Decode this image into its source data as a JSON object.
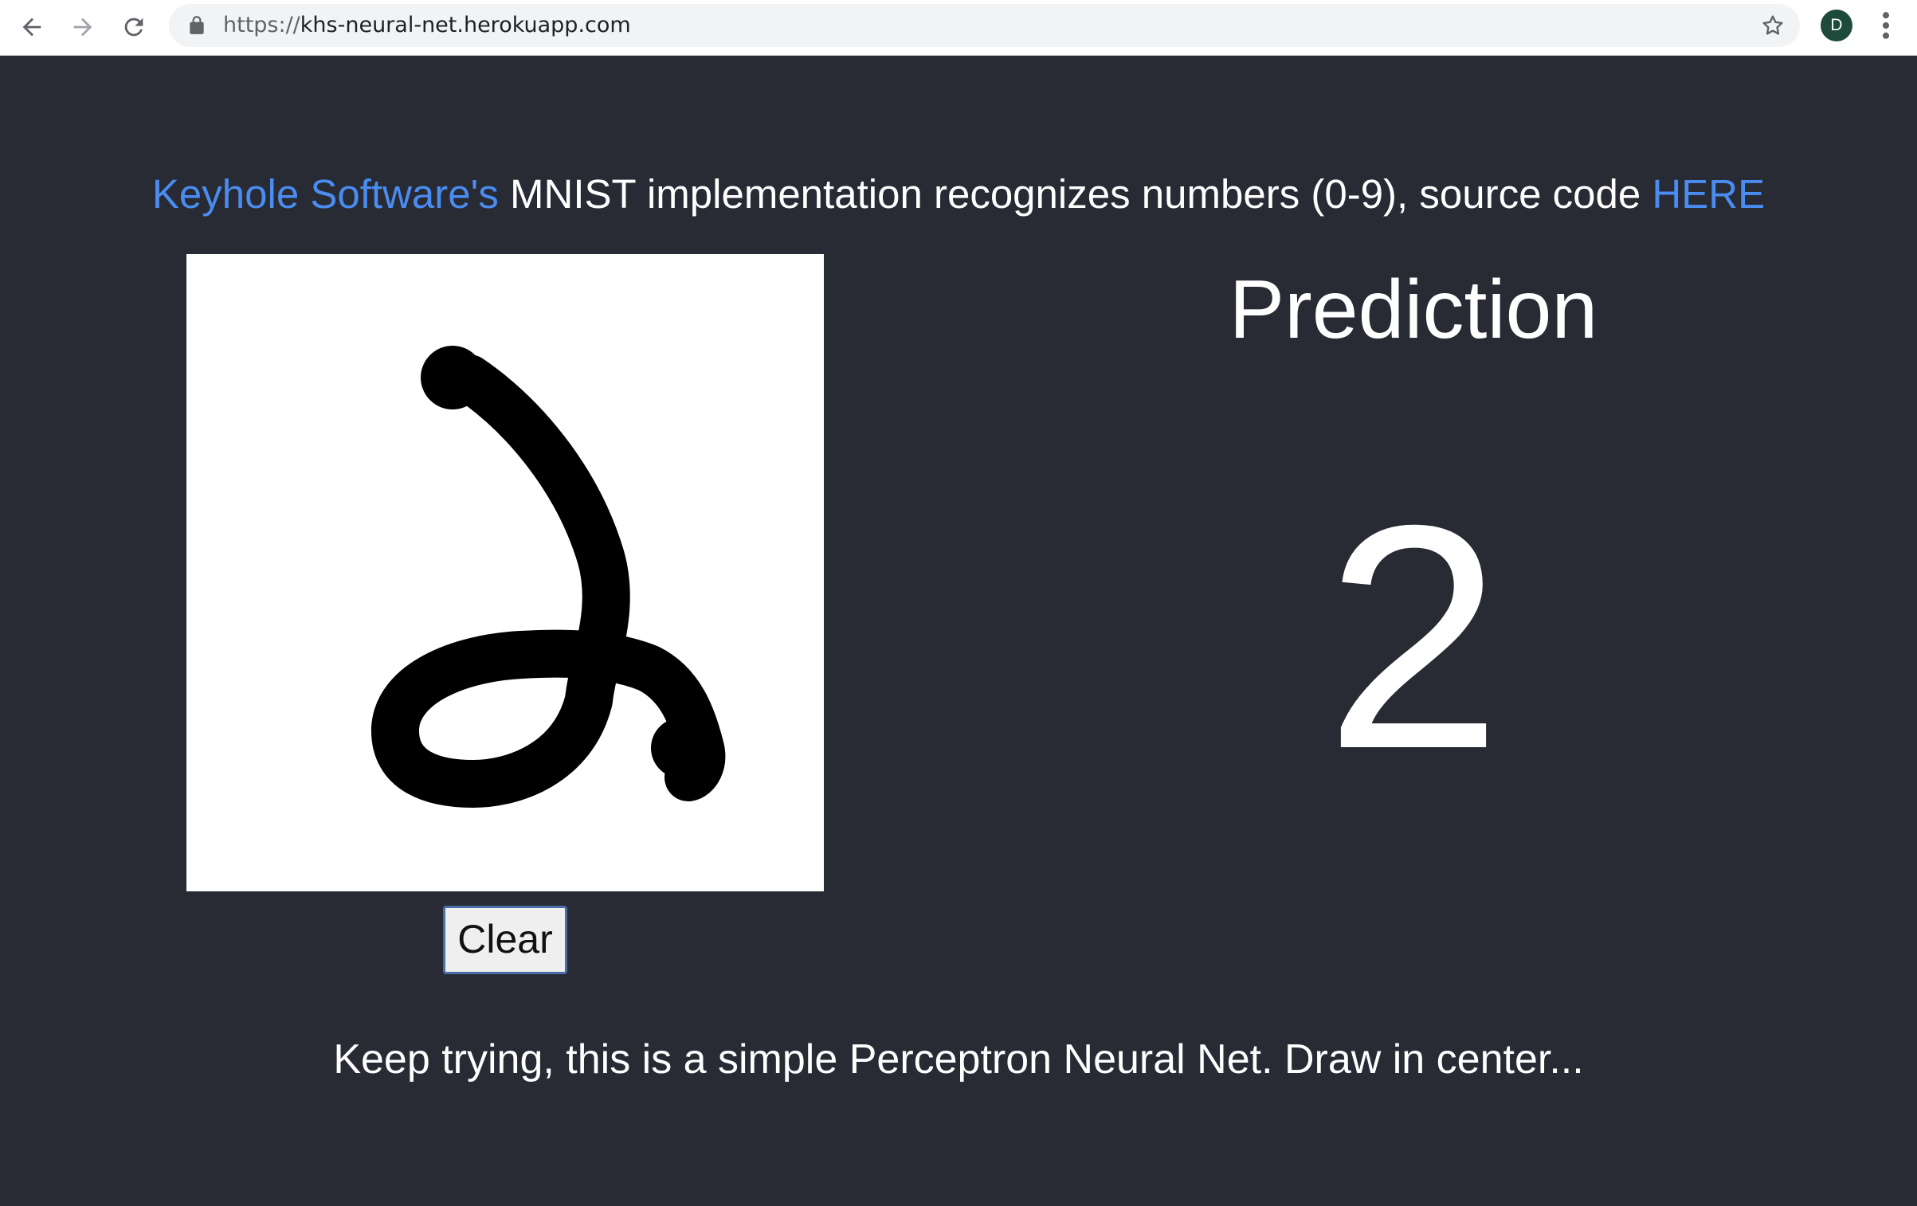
{
  "browser": {
    "url_scheme": "https://",
    "url_host": "khs-neural-net.herokuapp.com",
    "avatar_letter": "D"
  },
  "header": {
    "link_text": "Keyhole Software's",
    "middle_text": " MNIST implementation recognizes numbers (0-9), source code ",
    "source_link_text": "HERE"
  },
  "canvas": {
    "drawn_digit_description_icon": "handwritten-stroke"
  },
  "controls": {
    "clear_label": "Clear"
  },
  "prediction": {
    "title": "Prediction",
    "value": "2"
  },
  "footer": {
    "message": "Keep trying, this is a simple Perceptron Neural Net. Draw in center..."
  },
  "colors": {
    "page_background": "#282a34",
    "link": "#4a8cf0",
    "text": "#ffffff"
  }
}
